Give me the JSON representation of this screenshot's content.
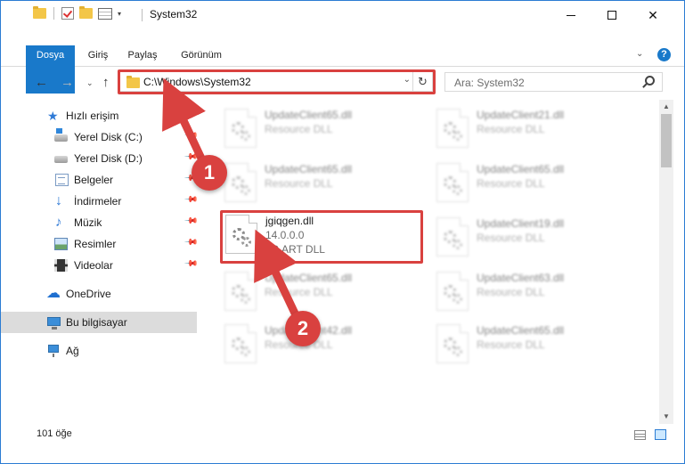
{
  "window": {
    "title": "System32",
    "controls": {
      "minimize": "minimize",
      "maximize": "maximize",
      "close": "✕"
    }
  },
  "ribbon": {
    "tabs": [
      {
        "label": "Dosya",
        "active": true
      },
      {
        "label": "Giriş"
      },
      {
        "label": "Paylaş"
      },
      {
        "label": "Görünüm"
      }
    ],
    "help": "?"
  },
  "nav": {
    "back": "←",
    "forward": "→",
    "recent": "⌄",
    "up": "↑",
    "address": "C:\\Windows\\System32",
    "address_dropdown": "⌄",
    "refresh": "↻",
    "search_placeholder": "Ara: System32"
  },
  "sidebar": {
    "items": [
      {
        "label": "Hızlı erişim",
        "icon": "star-icon"
      },
      {
        "label": "Yerel Disk (C:)",
        "icon": "drive-icon",
        "pinned": true
      },
      {
        "label": "Yerel Disk (D:)",
        "icon": "drive-icon",
        "pinned": true
      },
      {
        "label": "Belgeler",
        "icon": "documents-icon",
        "pinned": true
      },
      {
        "label": "İndirmeler",
        "icon": "downloads-icon",
        "pinned": true
      },
      {
        "label": "Müzik",
        "icon": "music-icon",
        "pinned": true
      },
      {
        "label": "Resimler",
        "icon": "pictures-icon",
        "pinned": true
      },
      {
        "label": "Videolar",
        "icon": "videos-icon",
        "pinned": true
      },
      {
        "label": "OneDrive",
        "icon": "cloud-icon"
      },
      {
        "label": "Bu bilgisayar",
        "icon": "computer-icon",
        "selected": true
      },
      {
        "label": "Ağ",
        "icon": "network-icon"
      }
    ]
  },
  "files": {
    "left_column": [
      {
        "name": "UpdateClient65.dll",
        "desc": "Resource DLL"
      },
      {
        "name": "UpdateClient65.dll",
        "desc": "Resource DLL"
      },
      {
        "name": "jgiqgen.dll",
        "version": "14.0.0.0",
        "desc": "JG ART DLL"
      },
      {
        "name": "UpdateClient65.dll",
        "desc": "Resource DLL"
      },
      {
        "name": "UpdateClient42.dll",
        "desc": "Resource DLL"
      }
    ],
    "right_column": [
      {
        "name": "UpdateClient21.dll",
        "desc": "Resource DLL"
      },
      {
        "name": "UpdateClient65.dll",
        "desc": "Resource DLL"
      },
      {
        "name": "UpdateClient19.dll",
        "desc": "Resource DLL"
      },
      {
        "name": "UpdateClient63.dll",
        "desc": "Resource DLL"
      },
      {
        "name": "UpdateClient65.dll",
        "desc": "Resource DLL"
      }
    ]
  },
  "status": {
    "item_count": "101 öğe"
  },
  "annotations": {
    "step1": "1",
    "step2": "2"
  },
  "colors": {
    "accent": "#1979ca",
    "highlight": "#d9413f",
    "selected_bg": "#dcdcdc"
  }
}
